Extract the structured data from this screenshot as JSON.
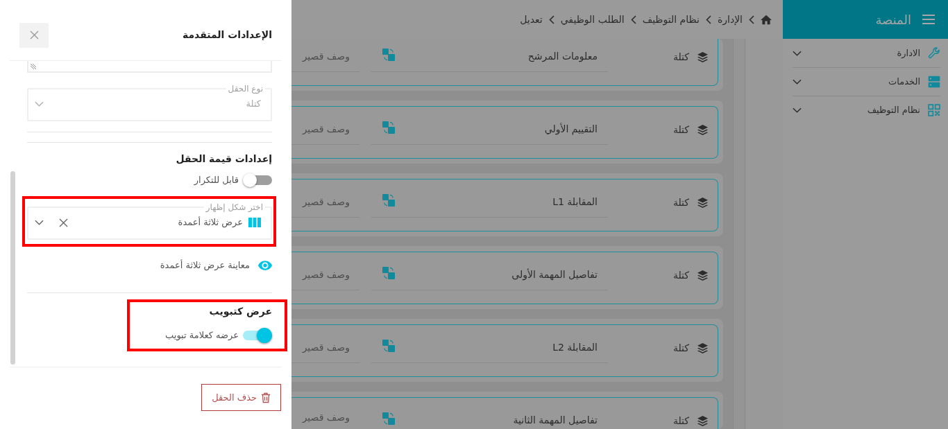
{
  "page": {
    "dimmed": true
  },
  "sidebar": {
    "title": "المنصة",
    "items": [
      {
        "label": "الادارة",
        "expanded": false
      },
      {
        "label": "الخدمات",
        "expanded": false
      },
      {
        "label": "نظام التوظيف",
        "expanded": false
      }
    ]
  },
  "breadcrumb": [
    "الإدارة",
    "نظام التوظيف",
    "الطلب الوظيفي",
    "تعديل"
  ],
  "blocks": [
    {
      "type": "كتلة",
      "title": "معلومات المرشح",
      "description_placeholder": "وصف قصير"
    },
    {
      "type": "كتلة",
      "title": "التقييم الأولي",
      "description_placeholder": "وصف قصير"
    },
    {
      "type": "كتلة",
      "title": "المقابلة L1",
      "description_placeholder": "وصف قصير"
    },
    {
      "type": "كتلة",
      "title": "تفاصيل المهمة الأولى",
      "description_placeholder": "وصف قصير"
    },
    {
      "type": "كتلة",
      "title": "المقابلة L2",
      "description_placeholder": "وصف قصير"
    },
    {
      "type": "كتلة",
      "title": "تفاصيل المهمة الثانية",
      "description_placeholder": "وصف قصير"
    }
  ],
  "panel": {
    "title": "الإعدادات المتقدمة",
    "textarea": {
      "resizable": true
    },
    "field_type": {
      "label": "نوع الحقل",
      "value": "كتلة",
      "disabled": true
    },
    "value_settings": {
      "heading": "إعدادات قيمة الحقل",
      "repeatable": {
        "label": "قابل للتكرار",
        "on": false
      },
      "display": {
        "label": "اختر شكل إظهار",
        "value": "عرض ثلاثة أعمدة",
        "clearable": true,
        "highlighted": true
      },
      "preview": "معاينة عرض ثلاثة أعمدة"
    },
    "tab_display": {
      "heading": "عرض كتبويب",
      "highlighted": true,
      "toggle": {
        "label": "عرضه كعلامة تبويب",
        "on": true
      }
    },
    "delete_button": "حذف الحقل"
  }
}
